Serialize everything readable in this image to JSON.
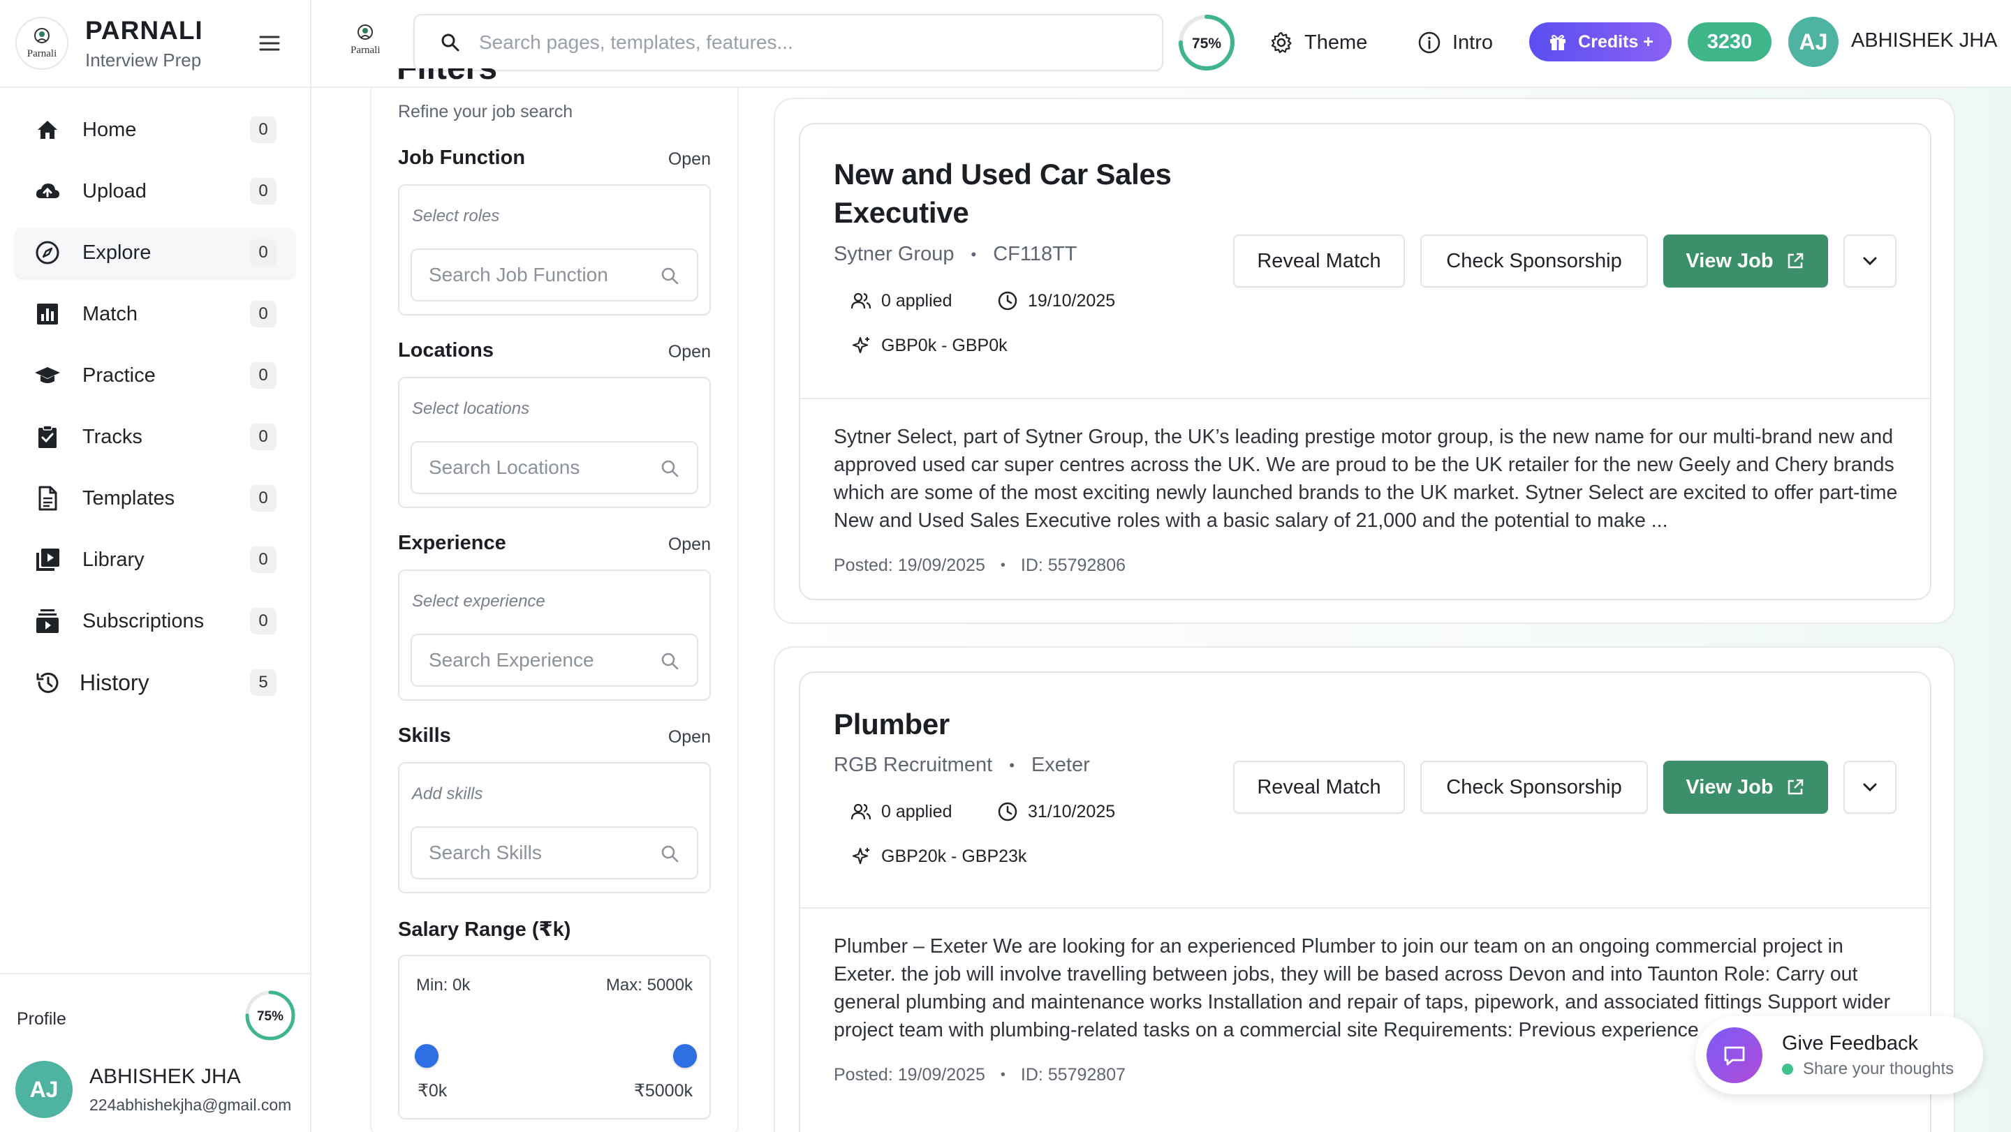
{
  "brand": {
    "name": "PARNALI",
    "subtitle": "Interview Prep",
    "logo_text": "Parnali"
  },
  "sidebar": {
    "items": [
      {
        "label": "Home",
        "count": "0",
        "icon": "home-icon"
      },
      {
        "label": "Upload",
        "count": "0",
        "icon": "cloud-upload-icon"
      },
      {
        "label": "Explore",
        "count": "0",
        "icon": "compass-icon"
      },
      {
        "label": "Match",
        "count": "0",
        "icon": "bar-chart-icon"
      },
      {
        "label": "Practice",
        "count": "0",
        "icon": "graduation-cap-icon"
      },
      {
        "label": "Tracks",
        "count": "0",
        "icon": "clipboard-check-icon"
      },
      {
        "label": "Templates",
        "count": "0",
        "icon": "document-icon"
      },
      {
        "label": "Library",
        "count": "0",
        "icon": "video-library-icon"
      },
      {
        "label": "Subscriptions",
        "count": "0",
        "icon": "subscriptions-icon"
      },
      {
        "label": "History",
        "count": "5",
        "icon": "history-icon"
      }
    ],
    "active": "Explore",
    "profile": {
      "label": "Profile",
      "completion_percent": 75,
      "completion_label": "75%",
      "initials": "AJ",
      "name": "ABHISHEK JHA",
      "email": "224abhishekjha@gmail.com"
    }
  },
  "topbar": {
    "search_placeholder": "Search pages, templates, features...",
    "progress_percent": 75,
    "progress_label": "75%",
    "theme_label": "Theme",
    "intro_label": "Intro",
    "credits_label": "Credits +",
    "points": "3230",
    "user_initials": "AJ",
    "user_name": "ABHISHEK JHA"
  },
  "filters": {
    "title": "Filters",
    "subtitle": "Refine your job search",
    "sections": [
      {
        "title": "Job Function",
        "toggle": "Open",
        "placeholder": "Select roles",
        "search_placeholder": "Search Job Function"
      },
      {
        "title": "Locations",
        "toggle": "Open",
        "placeholder": "Select locations",
        "search_placeholder": "Search Locations"
      },
      {
        "title": "Experience",
        "toggle": "Open",
        "placeholder": "Select experience",
        "search_placeholder": "Search Experience"
      },
      {
        "title": "Skills",
        "toggle": "Open",
        "placeholder": "Add skills",
        "search_placeholder": "Search Skills"
      }
    ],
    "salary": {
      "title": "Salary Range (₹k)",
      "min_label": "Min: 0k",
      "max_label": "Max: 5000k",
      "low_value": "₹0k",
      "high_value": "₹5000k",
      "range_min": 0,
      "range_max": 5000,
      "low": 0,
      "high": 5000
    }
  },
  "jobs": [
    {
      "title": "New and Used Car Sales Executive",
      "company": "Sytner Group",
      "location": "CF118TT",
      "applied": "0 applied",
      "deadline": "19/10/2025",
      "salary": "GBP0k - GBP0k",
      "reveal_label": "Reveal Match",
      "sponsorship_label": "Check Sponsorship",
      "view_label": "View Job",
      "description": "Sytner Select, part of Sytner Group, the UK’s leading prestige motor group, is the new name for our multi-brand new and approved used car super centres across the UK. We are proud to be the UK retailer for the new Geely and Chery brands which are some of the most exciting newly launched brands to the UK market. Sytner Select are excited to offer part-time New and Used Sales Executive roles with a basic salary of 21,000 and the potential to make ...",
      "posted": "Posted: 19/09/2025",
      "job_id": "ID: 55792806"
    },
    {
      "title": "Plumber",
      "company": "RGB Recruitment",
      "location": "Exeter",
      "applied": "0 applied",
      "deadline": "31/10/2025",
      "salary": "GBP20k - GBP23k",
      "reveal_label": "Reveal Match",
      "sponsorship_label": "Check Sponsorship",
      "view_label": "View Job",
      "description": "Plumber – Exeter We are looking for an experienced Plumber to join our team on an ongoing commercial project in Exeter. the job will involve travelling between jobs, they will be based across Devon and into Taunton Role: Carry out general plumbing and maintenance works Installation and repair of taps, pipework, and associated fittings Support wider project team with plumbing-related tasks on a commercial site Requirements: Previous experience",
      "posted": "Posted: 19/09/2025",
      "job_id": "ID: 55792807"
    }
  ],
  "feedback": {
    "title": "Give Feedback",
    "subtitle": "Share your thoughts"
  },
  "colors": {
    "accent_green": "#3b8f6a",
    "credits_purple": "#6a55f2",
    "points_green": "#3fb58a",
    "avatar_teal": "#4fb3a2",
    "ring_green": "#3fb58a",
    "slider_blue": "#2f6fe4"
  }
}
